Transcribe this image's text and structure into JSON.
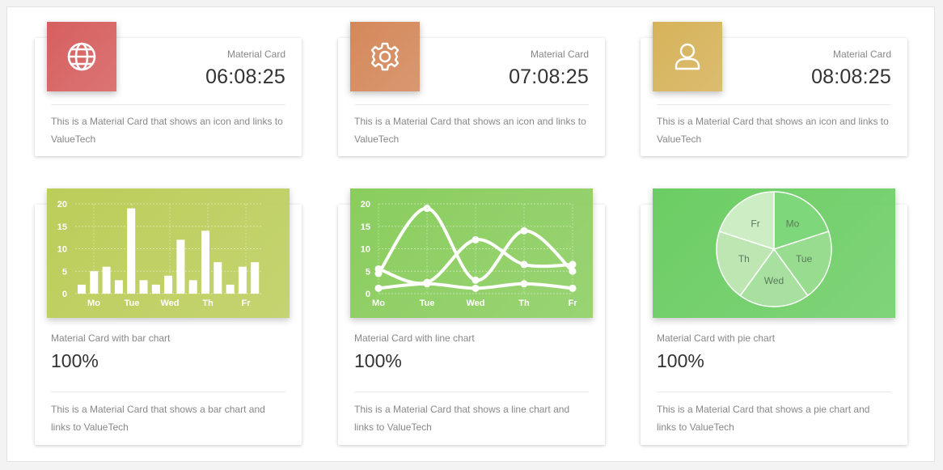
{
  "colors": {
    "card1_icon": "#d65f5f",
    "card2_icon": "#d4885a",
    "card3_icon": "#d6b35a",
    "bar_bg": "#bccd5a",
    "line_bg": "#8acd5e",
    "pie_bg": "#6ccd64"
  },
  "info_cards": [
    {
      "icon": "globe-icon",
      "category": "Material Card",
      "time": "06:08:25",
      "footer": "This is a Material Card that shows an icon and links to ValueTech"
    },
    {
      "icon": "gear-icon",
      "category": "Material Card",
      "time": "07:08:25",
      "footer": "This is a Material Card that shows an icon and links to ValueTech"
    },
    {
      "icon": "user-icon",
      "category": "Material Card",
      "time": "08:08:25",
      "footer": "This is a Material Card that shows an icon and links to ValueTech"
    }
  ],
  "chart_cards": [
    {
      "category": "Material Card with bar chart",
      "value": "100%",
      "footer": "This is a Material Card that shows a bar chart and links to ValueTech"
    },
    {
      "category": "Material Card with line chart",
      "value": "100%",
      "footer": "This is a Material Card that shows a line chart and links to ValueTech"
    },
    {
      "category": "Material Card with pie chart",
      "value": "100%",
      "footer": "This is a Material Card that shows a pie chart and links to ValueTech"
    }
  ],
  "chart_data": [
    {
      "type": "bar",
      "categories": [
        "Mo",
        "",
        "Tue",
        "",
        "Wed",
        "",
        "Th",
        "",
        "Fr"
      ],
      "x_tick_labels": [
        "Mo",
        "Tue",
        "Wed",
        "Th",
        "Fr"
      ],
      "y_ticks": [
        "0",
        "5",
        "10",
        "15",
        "20"
      ],
      "ylim": [
        0,
        20
      ],
      "grid": true,
      "series": [
        {
          "values": [
            2,
            5,
            3,
            2,
            2,
            12,
            3,
            7,
            2
          ]
        },
        {
          "values": [
            5,
            19,
            2,
            4,
            3,
            14,
            2,
            6,
            7
          ]
        },
        {
          "values": [
            6,
            3,
            4,
            12,
            14,
            7,
            6,
            7,
            7
          ]
        }
      ],
      "bars": [
        2,
        5,
        6,
        3,
        19,
        3,
        2,
        4,
        12,
        3,
        14,
        7,
        2,
        6,
        7
      ]
    },
    {
      "type": "line",
      "categories": [
        "Mo",
        "Tue",
        "Wed",
        "Th",
        "Fr"
      ],
      "y_ticks": [
        "0",
        "5",
        "10",
        "15",
        "20"
      ],
      "ylim": [
        0,
        20
      ],
      "grid": true,
      "series": [
        {
          "values": [
            4.5,
            19,
            3,
            14,
            5
          ]
        },
        {
          "values": [
            5.5,
            2.5,
            12,
            6.5,
            6.5
          ]
        },
        {
          "values": [
            1.2,
            2.2,
            1.2,
            2.2,
            1.2
          ]
        }
      ]
    },
    {
      "type": "pie",
      "categories": [
        "Mo",
        "Tue",
        "Wed",
        "Th",
        "Fr"
      ],
      "values": [
        20,
        20,
        20,
        20,
        20
      ],
      "slice_colors": [
        "#7fd77b",
        "#98dc8f",
        "#a8e09f",
        "#bde6b3",
        "#cdeec4"
      ]
    }
  ]
}
